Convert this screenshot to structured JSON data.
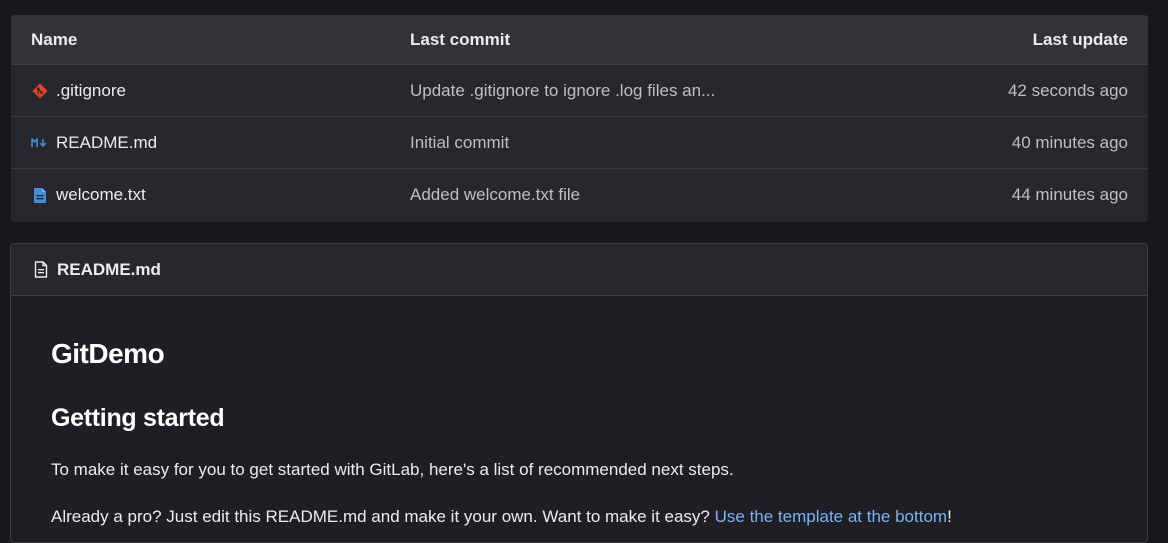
{
  "file_table": {
    "headers": {
      "name": "Name",
      "last_commit": "Last commit",
      "last_update": "Last update"
    },
    "rows": [
      {
        "name": ".gitignore",
        "icon": "git-icon",
        "commit": "Update .gitignore to ignore .log files an...",
        "updated": "42 seconds ago"
      },
      {
        "name": "README.md",
        "icon": "markdown-icon",
        "commit": "Initial commit",
        "updated": "40 minutes ago"
      },
      {
        "name": "welcome.txt",
        "icon": "text-file-icon",
        "commit": "Added welcome.txt file",
        "updated": "44 minutes ago"
      }
    ]
  },
  "readme": {
    "header_title": "README.md",
    "h1": "GitDemo",
    "h2": "Getting started",
    "p1": "To make it easy for you to get started with GitLab, here's a list of recommended next steps.",
    "p2_before": "Already a pro? Just edit this README.md and make it your own. Want to make it easy? ",
    "p2_link": "Use the template at the bottom",
    "p2_after": "!"
  },
  "colors": {
    "background": "#18171d",
    "table_header": "#333238",
    "table_row": "#28272d",
    "link": "#7cb3f0",
    "git_icon": "#e24329",
    "markdown_icon": "#428fdc",
    "text_file_icon": "#428fdc"
  }
}
